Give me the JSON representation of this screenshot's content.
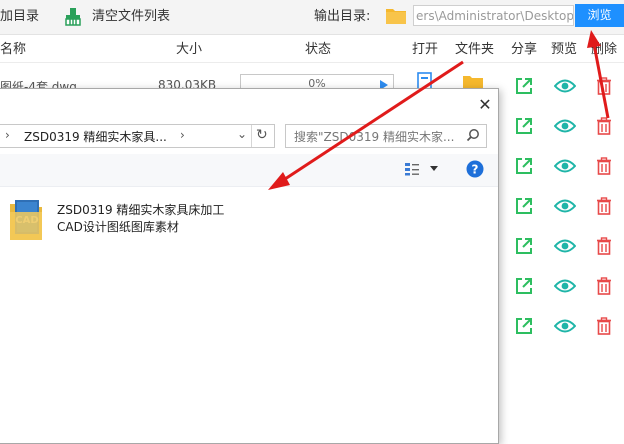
{
  "toolbar": {
    "add_dir_label": "加目录",
    "clear_list_label": "清空文件列表",
    "output_dir_label": "输出目录:",
    "output_dir_value": "ers\\Administrator\\Desktop",
    "browse_label": "浏览"
  },
  "table": {
    "headers": {
      "name": "名称",
      "size": "大小",
      "status": "状态",
      "open": "打开",
      "folder": "文件夹",
      "share": "分享",
      "preview": "预览",
      "delete": "删除"
    },
    "first_row": {
      "name": "图纸-4套.dwg",
      "size": "830.03KB",
      "progress": "0%"
    },
    "row_count": 7
  },
  "dialog": {
    "breadcrumb": "ZSD0319  精细实木家具...",
    "search_placeholder": "搜索\"ZSD0319  精细实木家...",
    "file_name_line1": "ZSD0319  精细实木家具床加工",
    "file_name_line2": "CAD设计图纸图库素材"
  },
  "colors": {
    "accent": "#1e90ff",
    "share_green": "#2dbe60",
    "preview_teal": "#1fb5a8",
    "delete_red": "#e84a4a",
    "annotation_red": "#e01b1b"
  }
}
